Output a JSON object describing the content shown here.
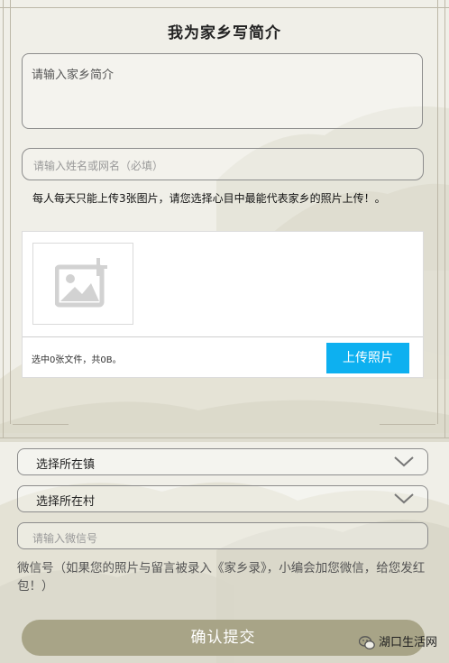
{
  "form": {
    "title": "我为家乡写简介",
    "intro_placeholder": "请输入家乡简介",
    "name_placeholder": "请输入姓名或网名（必填）",
    "notice": "每人每天只能上传3张图片，请您选择心目中最能代表家乡的照片上传！。"
  },
  "upload": {
    "thumbnail_icon": "add-image-icon",
    "status_text": "选中0张文件，共0B。",
    "upload_button_label": "上传照片",
    "button_color": "#0db0f0"
  },
  "location": {
    "town_select_label": "选择所在镇",
    "village_select_label": "选择所在村",
    "dropdown_icon": "chevron-down-icon"
  },
  "wechat": {
    "placeholder": "请输入微信号",
    "note": "微信号（如果您的照片与留言被录入《家乡录》，小编会加您微信，给您发红包！）"
  },
  "submit": {
    "label": "确认提交",
    "color": "#a8a487"
  },
  "watermark": {
    "text": "湖口生活网",
    "icon": "wechat-icon"
  }
}
